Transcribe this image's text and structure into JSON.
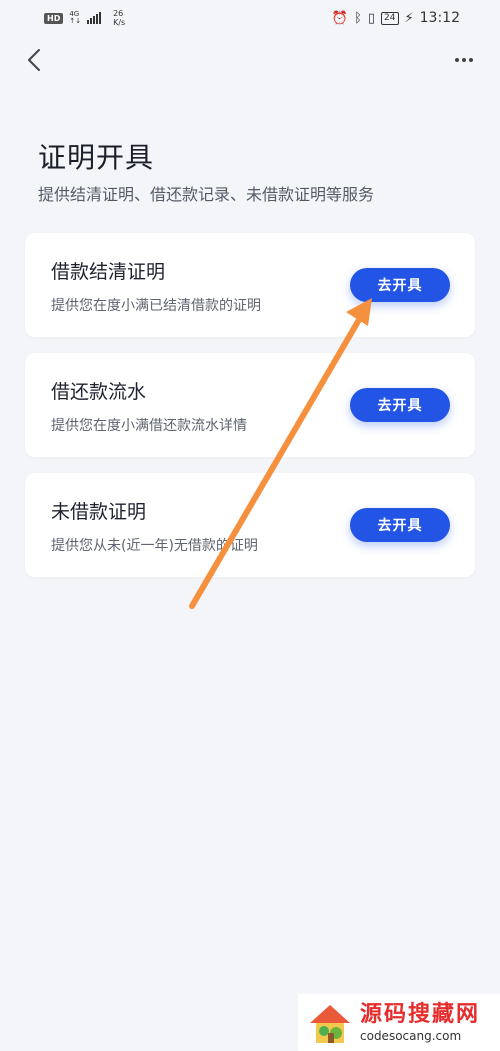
{
  "status_bar": {
    "hd": "HD",
    "net_top": "4G",
    "net_bottom": "↑↓",
    "speed_value": "26",
    "speed_unit": "K/s",
    "battery": "24",
    "time": "13:12"
  },
  "page": {
    "title": "证明开具",
    "subtitle": "提供结清证明、借还款记录、未借款证明等服务"
  },
  "cards": [
    {
      "title": "借款结清证明",
      "desc": "提供您在度小满已结清借款的证明",
      "button": "去开具"
    },
    {
      "title": "借还款流水",
      "desc": "提供您在度小满借还款流水详情",
      "button": "去开具"
    },
    {
      "title": "未借款证明",
      "desc": "提供您从未(近一年)无借款的证明",
      "button": "去开具"
    }
  ],
  "watermark": {
    "title": "源码搜藏网",
    "url": "codesocang.com"
  },
  "colors": {
    "accent": "#2255e6",
    "background": "#f3f5f9",
    "annotation_arrow": "#f5913e"
  }
}
